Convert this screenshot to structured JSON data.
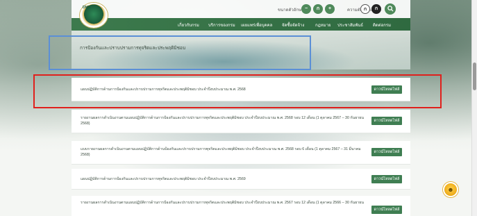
{
  "header": {
    "logo_text": "DMR",
    "font_size_label": "ขนาดตัวอักษร",
    "font_controls": [
      "−",
      "ก",
      "+"
    ],
    "contrast_label": "ความตัดกันของสี",
    "contrast_controls": [
      "ก",
      "ก"
    ],
    "search_icon": "search-icon"
  },
  "nav": {
    "items": [
      "เกี่ยวกับกรม",
      "บริการของกรม",
      "เผยแพร่เพื่อบุคคล",
      "จัดซื้อจัดจ้าง",
      "กฎหมาย",
      "ประชาสัมพันธ์",
      "ติดต่อกรม"
    ]
  },
  "banner": {
    "title": "การป้องกันและปราบปรามการทุจริตและประพฤติมิชอบ"
  },
  "documents": [
    {
      "title": "แผนปฏิบัติการด้านการป้องกันและปราบปรามการทุจริตและประพฤติมิชอบ ประจำปีงบประมาณ พ.ศ. 2568",
      "button": "ดาวน์โหลดไฟล์"
    },
    {
      "title": "รายงานผลการดำเนินงานตามแผนปฏิบัติการด้านการป้องกันและปราบปรามการทุจริตและประพฤติมิชอบ ประจำปีงบประมาณ พ.ศ. 2568 รอบ 12 เดือน (1 ตุลาคม 2567 – 30 กันยายน 2568)",
      "button": "ดาวน์โหลดไฟล์"
    },
    {
      "title": "แบบรายงานผลการดำเนินงานตามแผนปฏิบัติการด้านป้องกันและปราบปรามการทุจริตและประพฤติมิชอบ ประจำปีงบประมาณ พ.ศ. 2568 รอบ 6 เดือน (1 ตุลาคม 2567 – 31 มีนาคม 2568)",
      "button": "ดาวน์โหลดไฟล์"
    },
    {
      "title": "แผนปฏิบัติการด้านการป้องกันและปราบปรามการทุจริตและประพฤติมิชอบ ประจำปีงบประมาณ พ.ศ. 2569",
      "button": "ดาวน์โหลดไฟล์"
    },
    {
      "title": "รายงานผลการดำเนินงานตามแผนปฏิบัติการด้านการป้องกันและปราบปรามการทุจริตและประพฤติมิชอบ ประจำปีงบประมาณ พ.ศ. 2567 รอบ 12 เดือน (1 ตุลาคม 2566 – 30 กันยายน",
      "button": "ดาวน์โหลดไฟล์"
    }
  ],
  "colors": {
    "primary_green": "#3f7e52",
    "highlight_blue": "#5b8fd6",
    "highlight_red": "#e0201c"
  }
}
